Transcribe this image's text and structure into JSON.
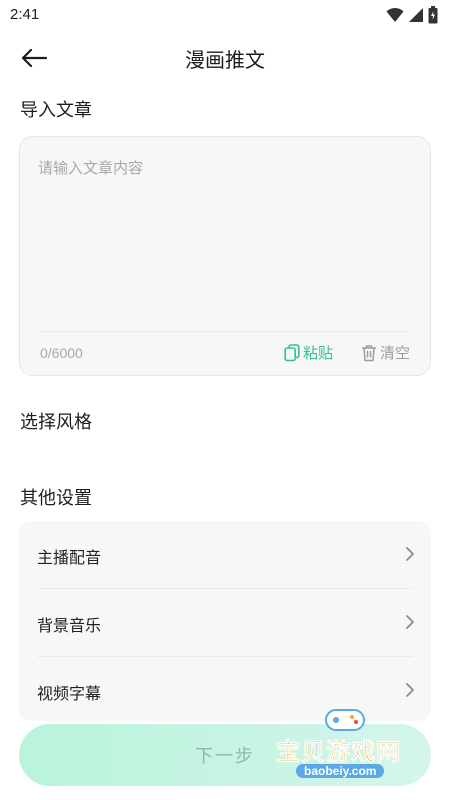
{
  "status_bar": {
    "time": "2:41",
    "icons": [
      "wifi-icon",
      "signal-icon",
      "battery-icon"
    ]
  },
  "header": {
    "title": "漫画推文"
  },
  "article": {
    "label": "导入文章",
    "placeholder": "请输入文章内容",
    "char_count": "0/6000",
    "paste_label": "粘贴",
    "clear_label": "清空"
  },
  "style_section": {
    "label": "选择风格"
  },
  "other_settings": {
    "label": "其他设置",
    "items": [
      {
        "label": "主播配音"
      },
      {
        "label": "背景音乐"
      },
      {
        "label": "视频字幕"
      }
    ]
  },
  "footer": {
    "next_label": "下一步"
  },
  "watermark": {
    "text": "宝贝游戏网",
    "url": "baobeiy.com"
  },
  "colors": {
    "accent": "#2fc389",
    "button_bg": "#c6f4e2",
    "card_bg": "#f7f7f7"
  }
}
